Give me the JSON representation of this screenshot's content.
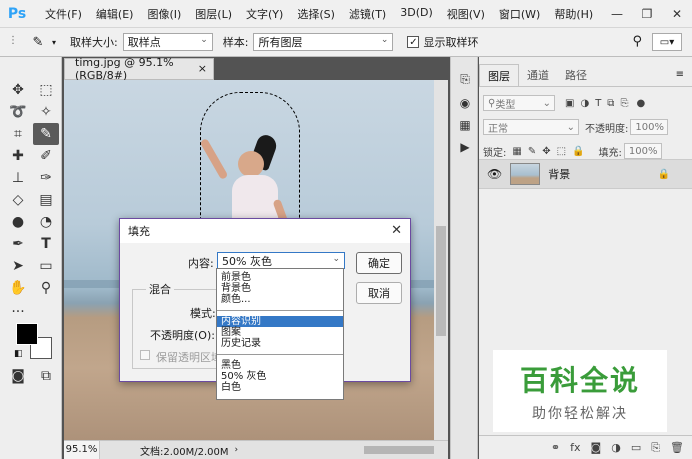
{
  "app": {
    "logo": "Ps"
  },
  "menu": [
    "文件(F)",
    "编辑(E)",
    "图像(I)",
    "图层(L)",
    "文字(Y)",
    "选择(S)",
    "滤镜(T)",
    "3D(D)",
    "视图(V)",
    "窗口(W)",
    "帮助(H)"
  ],
  "options": {
    "sample_size_label": "取样大小:",
    "sample_size_value": "取样点",
    "sample_label": "样本:",
    "sample_value": "所有图层",
    "show_ring_label": "显示取样环"
  },
  "document": {
    "tab_title": "timg.jpg @ 95.1%(RGB/8#)",
    "zoom": "95.1%",
    "doc_info": "文档:2.00M/2.00M"
  },
  "layers_panel": {
    "tabs": [
      "图层",
      "通道",
      "路径"
    ],
    "filter_kind": "类型",
    "blend_mode": "正常",
    "opacity_label": "不透明度:",
    "opacity_value": "100%",
    "lock_label": "锁定:",
    "fill_label": "填充:",
    "fill_value": "100%",
    "layer_name": "背景"
  },
  "fill_dialog": {
    "title": "填充",
    "content_label": "内容:",
    "content_value": "50% 灰色",
    "ok": "确定",
    "cancel": "取消",
    "blend_group": "混合",
    "mode_label": "模式:",
    "opacity_label": "不透明度(O):",
    "preserve_label": "保留透明区域"
  },
  "dropdown": {
    "group1": [
      "前景色",
      "背景色",
      "颜色..."
    ],
    "group2": [
      "内容识别",
      "图案",
      "历史记录"
    ],
    "group3": [
      "黑色",
      "50% 灰色",
      "白色"
    ],
    "selected": "内容识别"
  },
  "watermark": {
    "title": "百科全说",
    "subtitle": "助你轻松解决"
  },
  "colors": {
    "accent": "#3478c6",
    "ps_blue": "#2fa3f7",
    "watermark_green": "#3a9c3a"
  }
}
